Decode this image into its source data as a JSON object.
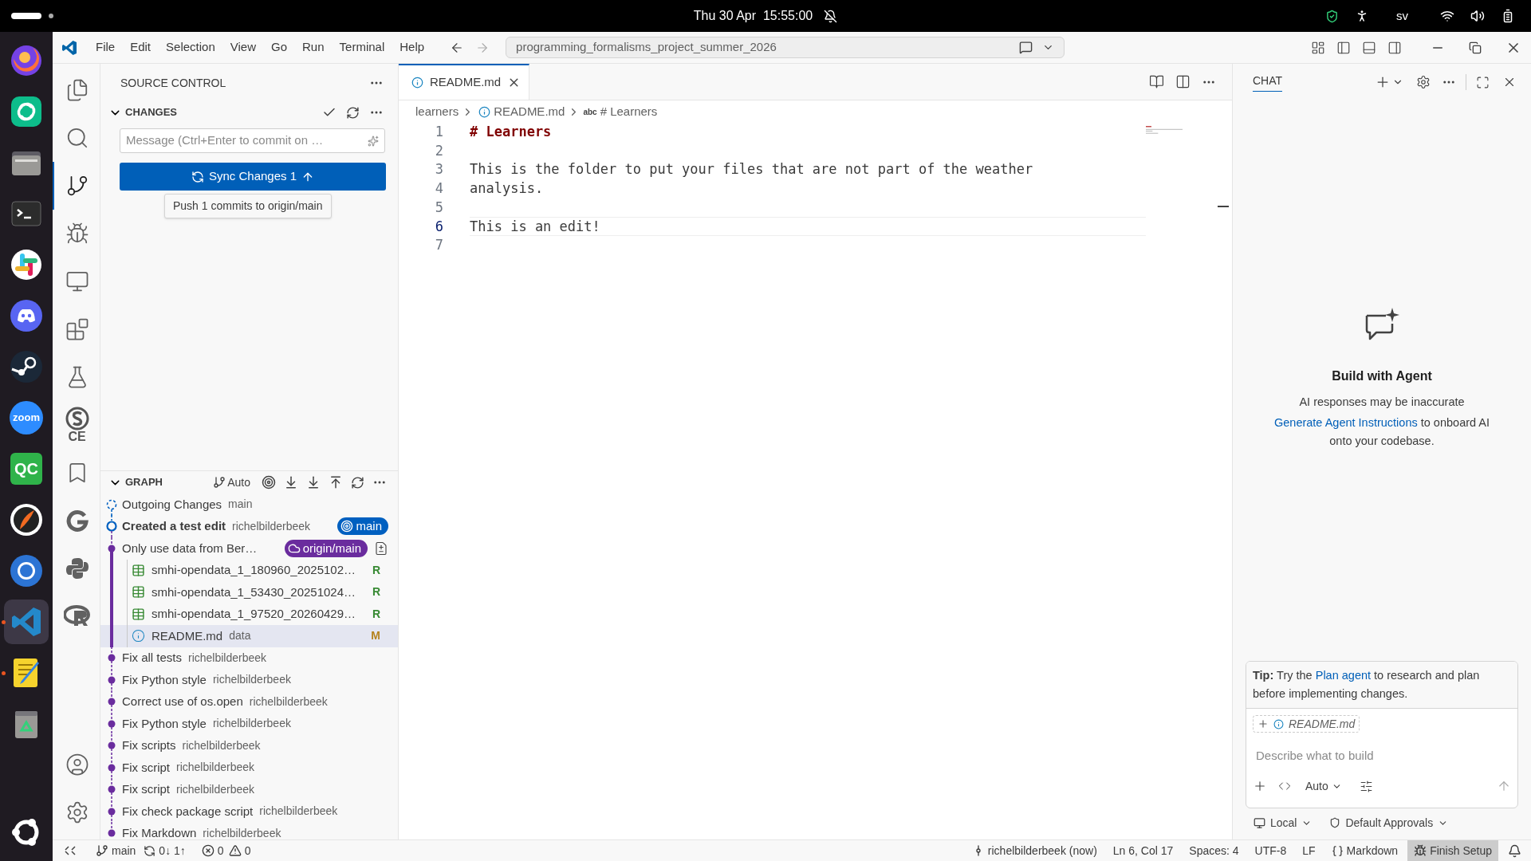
{
  "top_bar": {
    "clock": "Thu 30 Apr  15:55:00",
    "keyboard_layout": "sv"
  },
  "dock": [
    {
      "kind": "firefox",
      "selected": false,
      "running": false
    },
    {
      "kind": "element",
      "selected": false,
      "running": false
    },
    {
      "kind": "files",
      "selected": false,
      "running": false
    },
    {
      "kind": "terminal",
      "selected": false,
      "running": false
    },
    {
      "kind": "slack",
      "selected": false,
      "running": false
    },
    {
      "kind": "discord",
      "selected": false,
      "running": false
    },
    {
      "kind": "steam",
      "selected": false,
      "running": false
    },
    {
      "kind": "zoom",
      "label": "zoom",
      "selected": false,
      "running": false
    },
    {
      "kind": "qc",
      "label": "QC",
      "selected": false,
      "running": false
    },
    {
      "kind": "darktable",
      "selected": false,
      "running": false
    },
    {
      "kind": "chromium",
      "selected": false,
      "running": false
    },
    {
      "kind": "vscode",
      "selected": true,
      "running": true
    },
    {
      "kind": "texteditor",
      "selected": false,
      "running": true
    },
    {
      "kind": "trash",
      "selected": false,
      "running": false
    },
    {
      "kind": "apps",
      "selected": false,
      "running": false
    }
  ],
  "menu": [
    "File",
    "Edit",
    "Selection",
    "View",
    "Go",
    "Run",
    "Terminal",
    "Help"
  ],
  "command_center": "programming_formalisms_project_summer_2026",
  "activity_bar": [
    {
      "kind": "explorer",
      "selected": false
    },
    {
      "kind": "search",
      "selected": false
    },
    {
      "kind": "source_control",
      "selected": true
    },
    {
      "kind": "debug",
      "selected": false
    },
    {
      "kind": "remote",
      "selected": false
    },
    {
      "kind": "extensions",
      "selected": false
    },
    {
      "kind": "testing",
      "selected": false
    },
    {
      "kind": "sonar",
      "label": "CE",
      "selected": false
    },
    {
      "kind": "bookmarks",
      "selected": false
    },
    {
      "kind": "gitlens",
      "selected": false
    },
    {
      "kind": "python",
      "selected": false
    },
    {
      "kind": "r",
      "selected": false
    }
  ],
  "activity_bar_bottom": [
    {
      "kind": "accounts"
    },
    {
      "kind": "manage"
    }
  ],
  "source_control": {
    "title": "SOURCE CONTROL",
    "changes": {
      "title": "CHANGES",
      "expanded": true,
      "message_placeholder": "Message (Ctrl+Enter to commit on …",
      "sync_button": "Sync Changes 1",
      "tooltip": "Push 1 commits to origin/main"
    }
  },
  "graph": {
    "title": "GRAPH",
    "expanded": true,
    "mode": "Auto",
    "rows": [
      {
        "kind": "outgoing",
        "message": "Outgoing Changes",
        "author": "main"
      },
      {
        "kind": "commit",
        "message": "Created a test edit",
        "author": "richelbilderbeek",
        "current": true,
        "badge": {
          "label": "main",
          "color": "#0060c0",
          "kind": "local"
        }
      },
      {
        "kind": "commit",
        "message": "Only use data from Ber…",
        "current": false,
        "badge": {
          "label": "origin/main",
          "color": "#6a2c9e",
          "kind": "remote"
        },
        "children": [
          {
            "name": "smhi-opendata_1_180960_2025102…",
            "kind": "csv",
            "color": "#388a34",
            "status": "R",
            "selected": false
          },
          {
            "name": "smhi-opendata_1_53430_20251024…",
            "kind": "csv",
            "color": "#388a34",
            "status": "R",
            "selected": false
          },
          {
            "name": "smhi-opendata_1_97520_20260429…",
            "kind": "csv",
            "color": "#388a34",
            "status": "R",
            "selected": false
          },
          {
            "name": "README.md",
            "folder": "data",
            "kind": "markdown",
            "color": "#b5831f",
            "status": "M",
            "selected": true
          }
        ]
      },
      {
        "kind": "commit",
        "message": "Fix all tests",
        "author": "richelbilderbeek",
        "current": false
      },
      {
        "kind": "commit",
        "message": "Fix Python style",
        "author": "richelbilderbeek",
        "current": false
      },
      {
        "kind": "commit",
        "message": "Correct use of os.open",
        "author": "richelbilderbeek",
        "current": false
      },
      {
        "kind": "commit",
        "message": "Fix Python style",
        "author": "richelbilderbeek",
        "current": false
      },
      {
        "kind": "commit",
        "message": "Fix scripts",
        "author": "richelbilderbeek",
        "current": false
      },
      {
        "kind": "commit",
        "message": "Fix script",
        "author": "richelbilderbeek",
        "current": false
      },
      {
        "kind": "commit",
        "message": "Fix script",
        "author": "richelbilderbeek",
        "current": false
      },
      {
        "kind": "commit",
        "message": "Fix check package script",
        "author": "richelbilderbeek",
        "current": false
      },
      {
        "kind": "commit",
        "message": "Fix Markdown",
        "author": "richelbilderbeek",
        "current": false
      }
    ]
  },
  "editor": {
    "tabs": [
      {
        "label": "README.md",
        "selected": true
      }
    ],
    "breadcrumb": [
      {
        "kind": "folder",
        "label": "learners"
      },
      {
        "kind": "file",
        "label": "README.md"
      },
      {
        "kind": "symbol",
        "icon_text": "abc",
        "label": "# Learners"
      }
    ],
    "lines": [
      {
        "number": "1",
        "text": "# Learners",
        "kind": "heading",
        "current": false
      },
      {
        "number": "2",
        "current": false
      },
      {
        "number": "3",
        "text": "This is the folder to put your files that are not part of the weather",
        "kind": "text",
        "current": false
      },
      {
        "number": "4",
        "text": "analysis.",
        "kind": "text",
        "current": false
      },
      {
        "number": "5",
        "current": false
      },
      {
        "number": "6",
        "text": "This is an edit!",
        "kind": "text",
        "current": true
      },
      {
        "number": "7",
        "current": false
      }
    ]
  },
  "chat": {
    "title": "CHAT",
    "heading": "Build with Agent",
    "notice": "AI responses may be inaccurate",
    "link": "Generate Agent Instructions",
    "after_link": "to onboard AI onto your codebase.",
    "tip": {
      "lead": "Tip:",
      "before": "Try the",
      "link": "Plan agent",
      "after": "to research and plan before implementing changes."
    },
    "attachment": "README.md",
    "input_placeholder": "Describe what to build",
    "mode": "Auto",
    "location": "Local",
    "approvals": "Default Approvals"
  },
  "status_bar": {
    "branch": "main",
    "sync": "0↓ 1↑",
    "errors": "0",
    "warnings": "0",
    "blame": "richelbilderbeek (now)",
    "cursor": "Ln 6, Col 17",
    "indent": "Spaces: 4",
    "encoding": "UTF-8",
    "eol": "LF",
    "language": "Markdown",
    "setup": "Finish Setup"
  }
}
